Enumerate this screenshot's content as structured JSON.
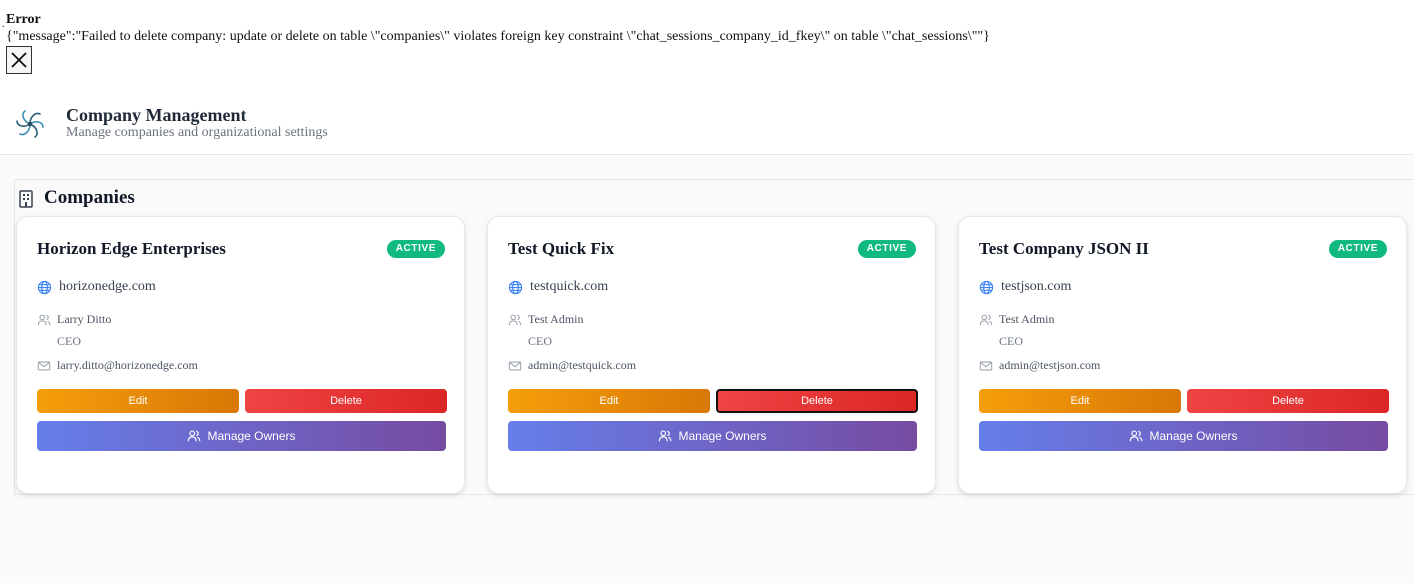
{
  "error": {
    "title": "Error",
    "message": "{\"message\":\"Failed to delete company: update or delete on table \\\"companies\\\" violates foreign key constraint \\\"chat_sessions_company_id_fkey\\\" on table \\\"chat_sessions\\\"\"}",
    "close_icon": "close-icon"
  },
  "header": {
    "title": "Company Management",
    "subtitle": "Manage companies and organizational settings",
    "logo_icon": "swirl-logo"
  },
  "section": {
    "title": "Companies",
    "icon": "building-icon"
  },
  "companies": [
    {
      "name": "Horizon Edge Enterprises",
      "status": "ACTIVE",
      "domain": "horizonedge.com",
      "contact_name": "Larry Ditto",
      "contact_role": "CEO",
      "contact_email": "larry.ditto@horizonedge.com",
      "edit_label": "Edit",
      "delete_label": "Delete",
      "owners_label": "Manage Owners"
    },
    {
      "name": "Test Quick Fix",
      "status": "ACTIVE",
      "domain": "testquick.com",
      "contact_name": "Test Admin",
      "contact_role": "CEO",
      "contact_email": "admin@testquick.com",
      "edit_label": "Edit",
      "delete_label": "Delete",
      "owners_label": "Manage Owners"
    },
    {
      "name": "Test Company JSON II",
      "status": "ACTIVE",
      "domain": "testjson.com",
      "contact_name": "Test Admin",
      "contact_role": "CEO",
      "contact_email": "admin@testjson.com",
      "edit_label": "Edit",
      "delete_label": "Delete",
      "owners_label": "Manage Owners"
    }
  ],
  "colors": {
    "active_badge": "#10b981",
    "edit_button": "#f59e0b",
    "delete_button": "#ef4444",
    "owners_gradient_start": "#667eea",
    "owners_gradient_end": "#764ba2"
  }
}
